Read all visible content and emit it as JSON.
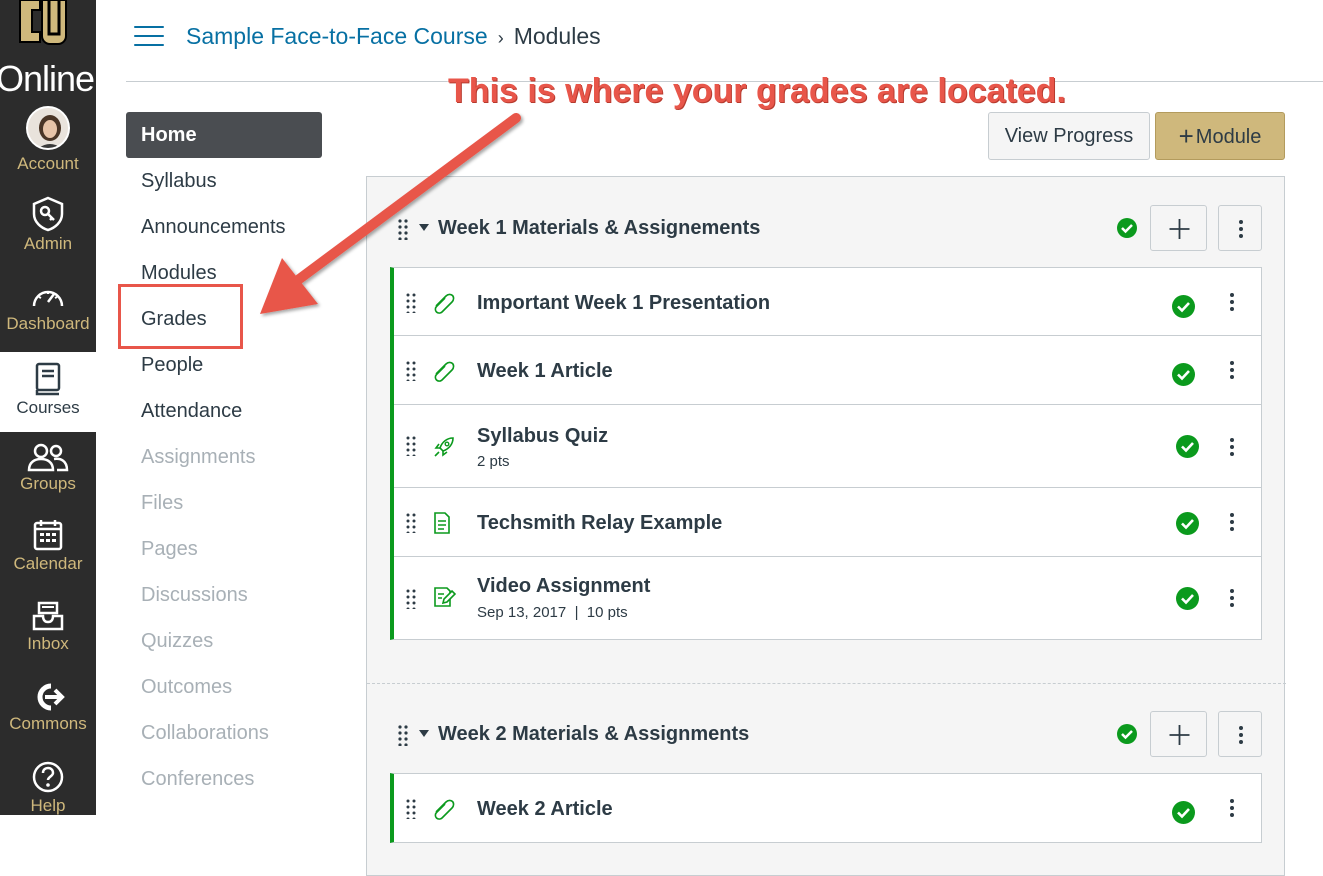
{
  "global_nav": {
    "brand": "Online",
    "items": [
      {
        "label": "Account",
        "icon": "avatar"
      },
      {
        "label": "Admin",
        "icon": "shield-key-icon"
      },
      {
        "label": "Dashboard",
        "icon": "speedometer-icon"
      },
      {
        "label": "Courses",
        "icon": "book-icon"
      },
      {
        "label": "Groups",
        "icon": "people-icon"
      },
      {
        "label": "Calendar",
        "icon": "calendar-icon"
      },
      {
        "label": "Inbox",
        "icon": "inbox-icon"
      },
      {
        "label": "Commons",
        "icon": "commons-icon"
      },
      {
        "label": "Help",
        "icon": "question-icon"
      }
    ]
  },
  "breadcrumb": {
    "course": "Sample Face-to-Face Course",
    "separator": "›",
    "current": "Modules"
  },
  "course_nav": {
    "items": [
      {
        "label": "Home",
        "state": "active"
      },
      {
        "label": "Syllabus",
        "state": "enabled"
      },
      {
        "label": "Announcements",
        "state": "enabled"
      },
      {
        "label": "Modules",
        "state": "enabled"
      },
      {
        "label": "Grades",
        "state": "enabled"
      },
      {
        "label": "People",
        "state": "enabled"
      },
      {
        "label": "Attendance",
        "state": "enabled"
      },
      {
        "label": "Assignments",
        "state": "disabled"
      },
      {
        "label": "Files",
        "state": "disabled"
      },
      {
        "label": "Pages",
        "state": "disabled"
      },
      {
        "label": "Discussions",
        "state": "disabled"
      },
      {
        "label": "Quizzes",
        "state": "disabled"
      },
      {
        "label": "Outcomes",
        "state": "disabled"
      },
      {
        "label": "Collaborations",
        "state": "disabled"
      },
      {
        "label": "Conferences",
        "state": "disabled"
      }
    ]
  },
  "annotation": {
    "text": "This is where your grades are located.",
    "color": "#e8564a"
  },
  "toolbar": {
    "view_progress": "View Progress",
    "add_module": "Module"
  },
  "modules": [
    {
      "title": "Week 1 Materials & Assignements",
      "items": [
        {
          "name": "Important Week 1 Presentation",
          "icon": "paperclip-icon",
          "sub": ""
        },
        {
          "name": "Week 1 Article",
          "icon": "paperclip-icon",
          "sub": ""
        },
        {
          "name": "Syllabus Quiz",
          "icon": "rocket-icon",
          "sub": "2 pts"
        },
        {
          "name": "Techsmith Relay Example",
          "icon": "document-icon",
          "sub": ""
        },
        {
          "name": "Video Assignment",
          "icon": "assignment-icon",
          "sub": "Sep 13, 2017  |  10 pts"
        }
      ]
    },
    {
      "title": "Week 2 Materials & Assignments",
      "items": [
        {
          "name": "Week 2 Article",
          "icon": "paperclip-icon",
          "sub": ""
        }
      ]
    }
  ],
  "colors": {
    "nav_bg": "#2c2c2c",
    "gold": "#cfb87c",
    "link": "#0770a3",
    "success": "#0b9a1d"
  }
}
